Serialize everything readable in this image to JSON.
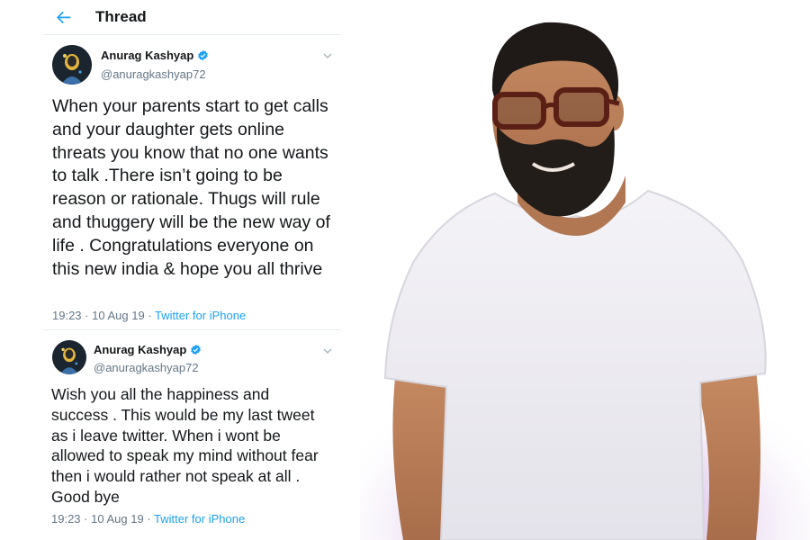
{
  "header": {
    "title": "Thread"
  },
  "tweets": [
    {
      "display_name": "Anurag Kashyap",
      "handle": "@anuragkashyap72",
      "text": "When your parents start to get calls and your daughter gets online threats you know that no one wants to talk .There isn’t going to be reason or rationale. Thugs will rule and thuggery will be the new way of life . Congratulations everyone on this new india & hope you all thrive",
      "time": "19:23",
      "date": "10 Aug 19",
      "source": "Twitter for iPhone"
    },
    {
      "display_name": "Anurag Kashyap",
      "handle": "@anuragkashyap72",
      "text": "Wish you all the happiness and success . This would be my last tweet as i leave twitter. When i wont be allowed to speak my mind without fear then i would rather not speak at all . Good bye",
      "time": "19:23",
      "date": "10 Aug 19",
      "source": "Twitter for iPhone"
    }
  ],
  "colors": {
    "accent": "#1da1f2",
    "verified": "#1da1f2",
    "muted": "#657786",
    "text": "#14171a",
    "shirt": "#efeef3",
    "background_glow": "#c9a6d8"
  },
  "icons": {
    "back": "arrow-left-icon",
    "verified": "verified-badge-icon",
    "more": "chevron-down-icon"
  }
}
